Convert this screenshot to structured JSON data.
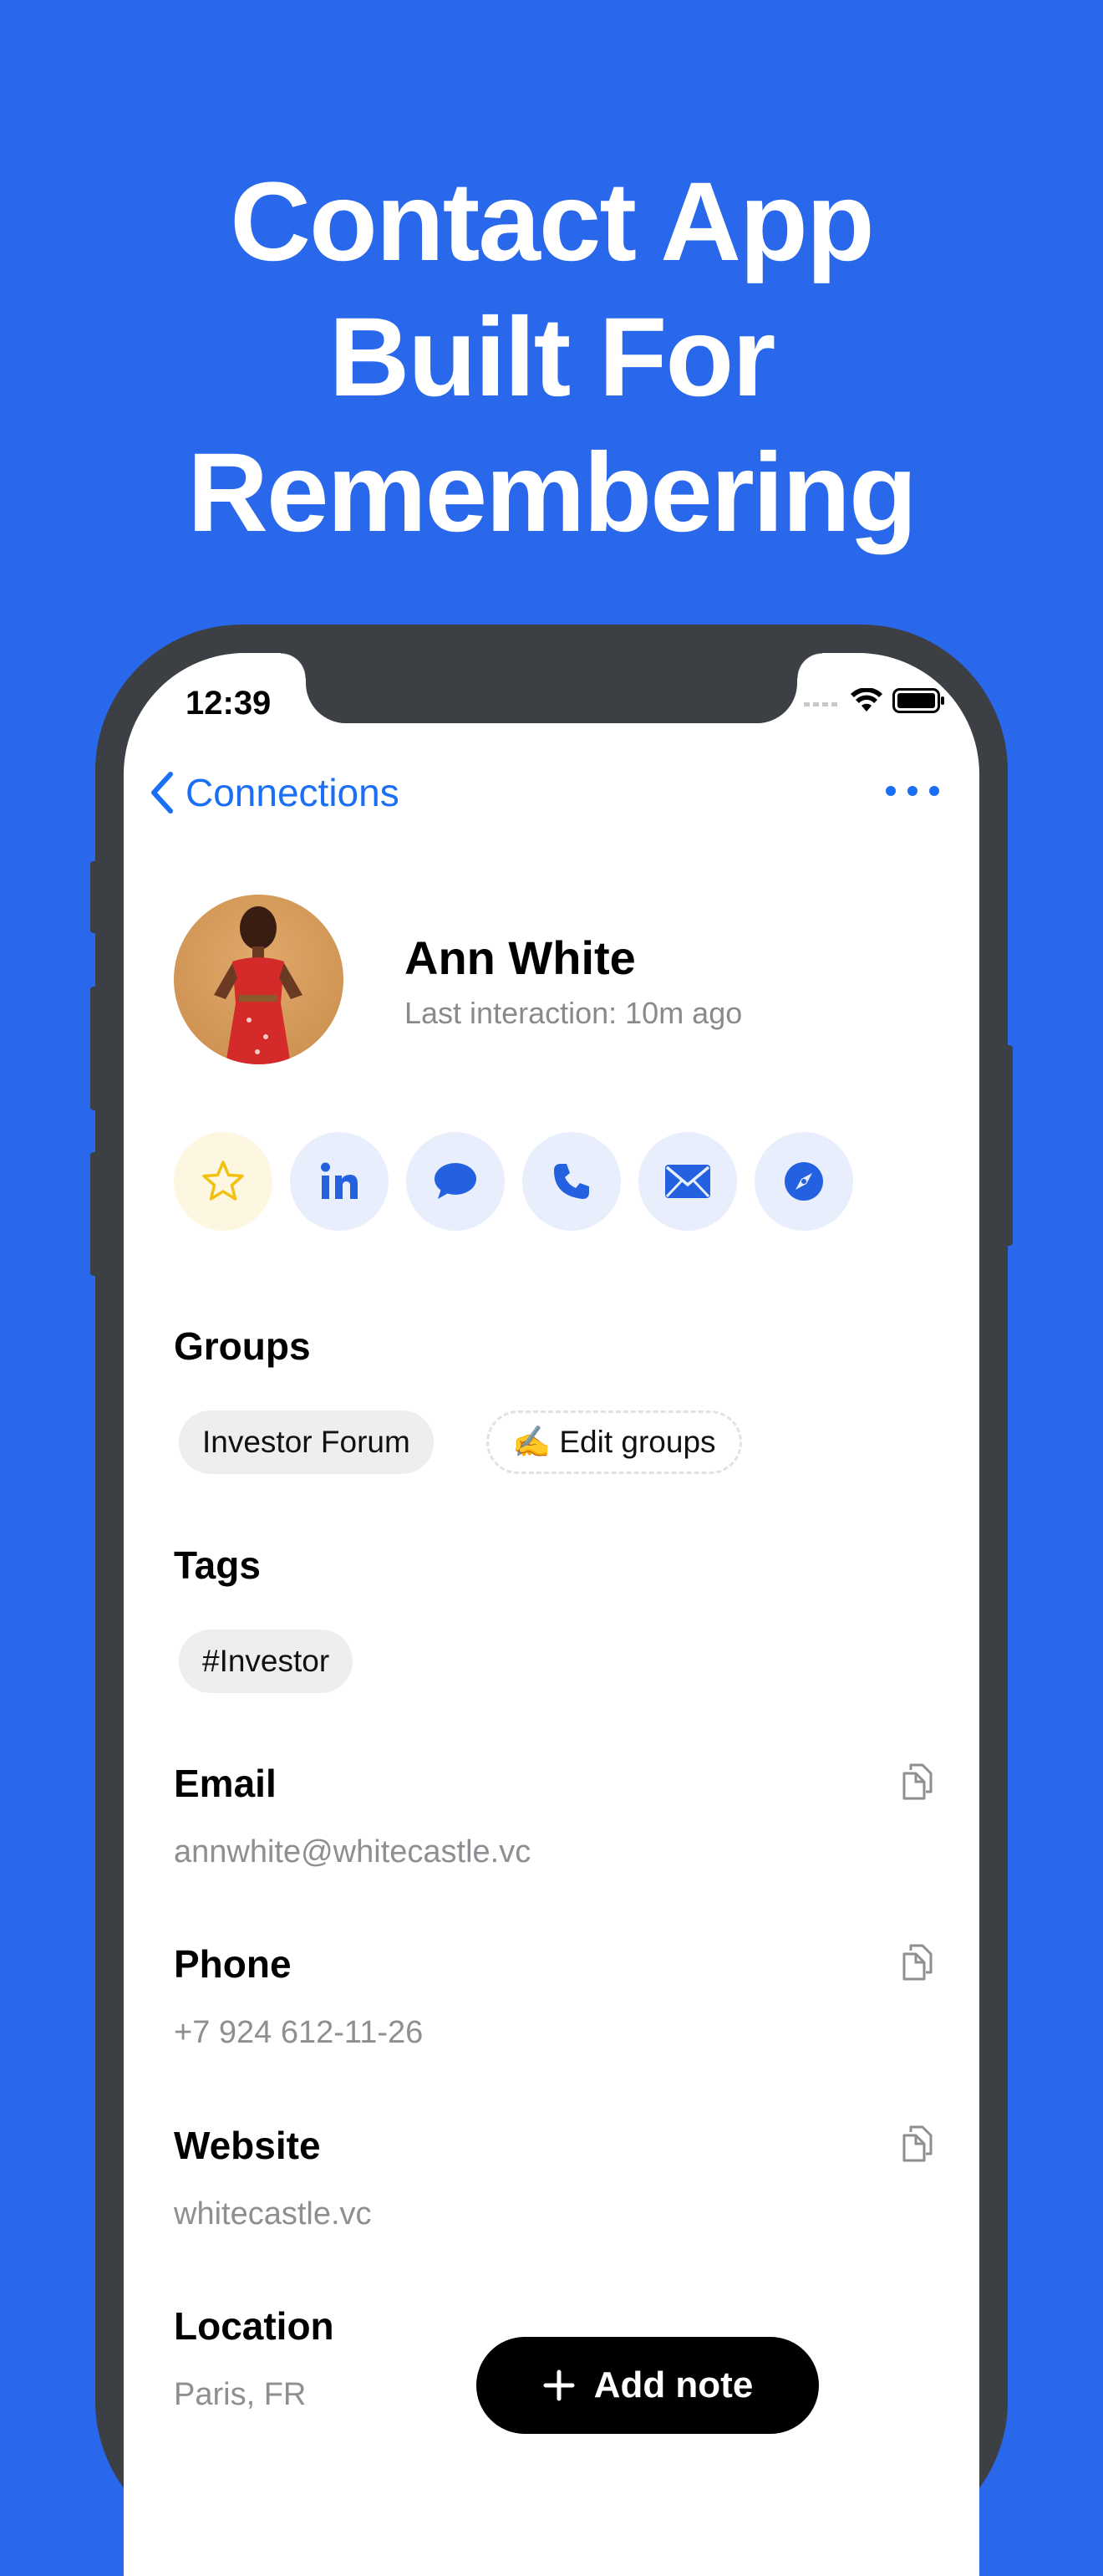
{
  "promo": {
    "headline_line1": "Contact App",
    "headline_line2": "Built For",
    "headline_line3": "Remembering",
    "background_color": "#2a68eb"
  },
  "status_bar": {
    "time": "12:39",
    "icons": [
      "cellular-icon",
      "wifi-icon",
      "battery-icon"
    ]
  },
  "nav": {
    "back_label": "Connections",
    "more_icon": "ellipsis-icon",
    "accent_color": "#1b6ff5"
  },
  "contact": {
    "name": "Ann White",
    "last_interaction": "Last interaction: 10m ago"
  },
  "actions": [
    {
      "icon": "star-icon"
    },
    {
      "icon": "linkedin-icon"
    },
    {
      "icon": "message-icon"
    },
    {
      "icon": "phone-icon"
    },
    {
      "icon": "mail-icon"
    },
    {
      "icon": "compass-icon"
    }
  ],
  "groups": {
    "title": "Groups",
    "items": [
      "Investor Forum"
    ],
    "edit_label": "✍️ Edit groups"
  },
  "tags": {
    "title": "Tags",
    "items": [
      "#Investor"
    ]
  },
  "fields": {
    "email": {
      "label": "Email",
      "value": "annwhite@whitecastle.vc"
    },
    "phone": {
      "label": "Phone",
      "value": "+7 924 612-11-26"
    },
    "website": {
      "label": "Website",
      "value": "whitecastle.vc"
    },
    "location": {
      "label": "Location",
      "value": "Paris, FR"
    }
  },
  "add_note": {
    "label": "Add note"
  }
}
